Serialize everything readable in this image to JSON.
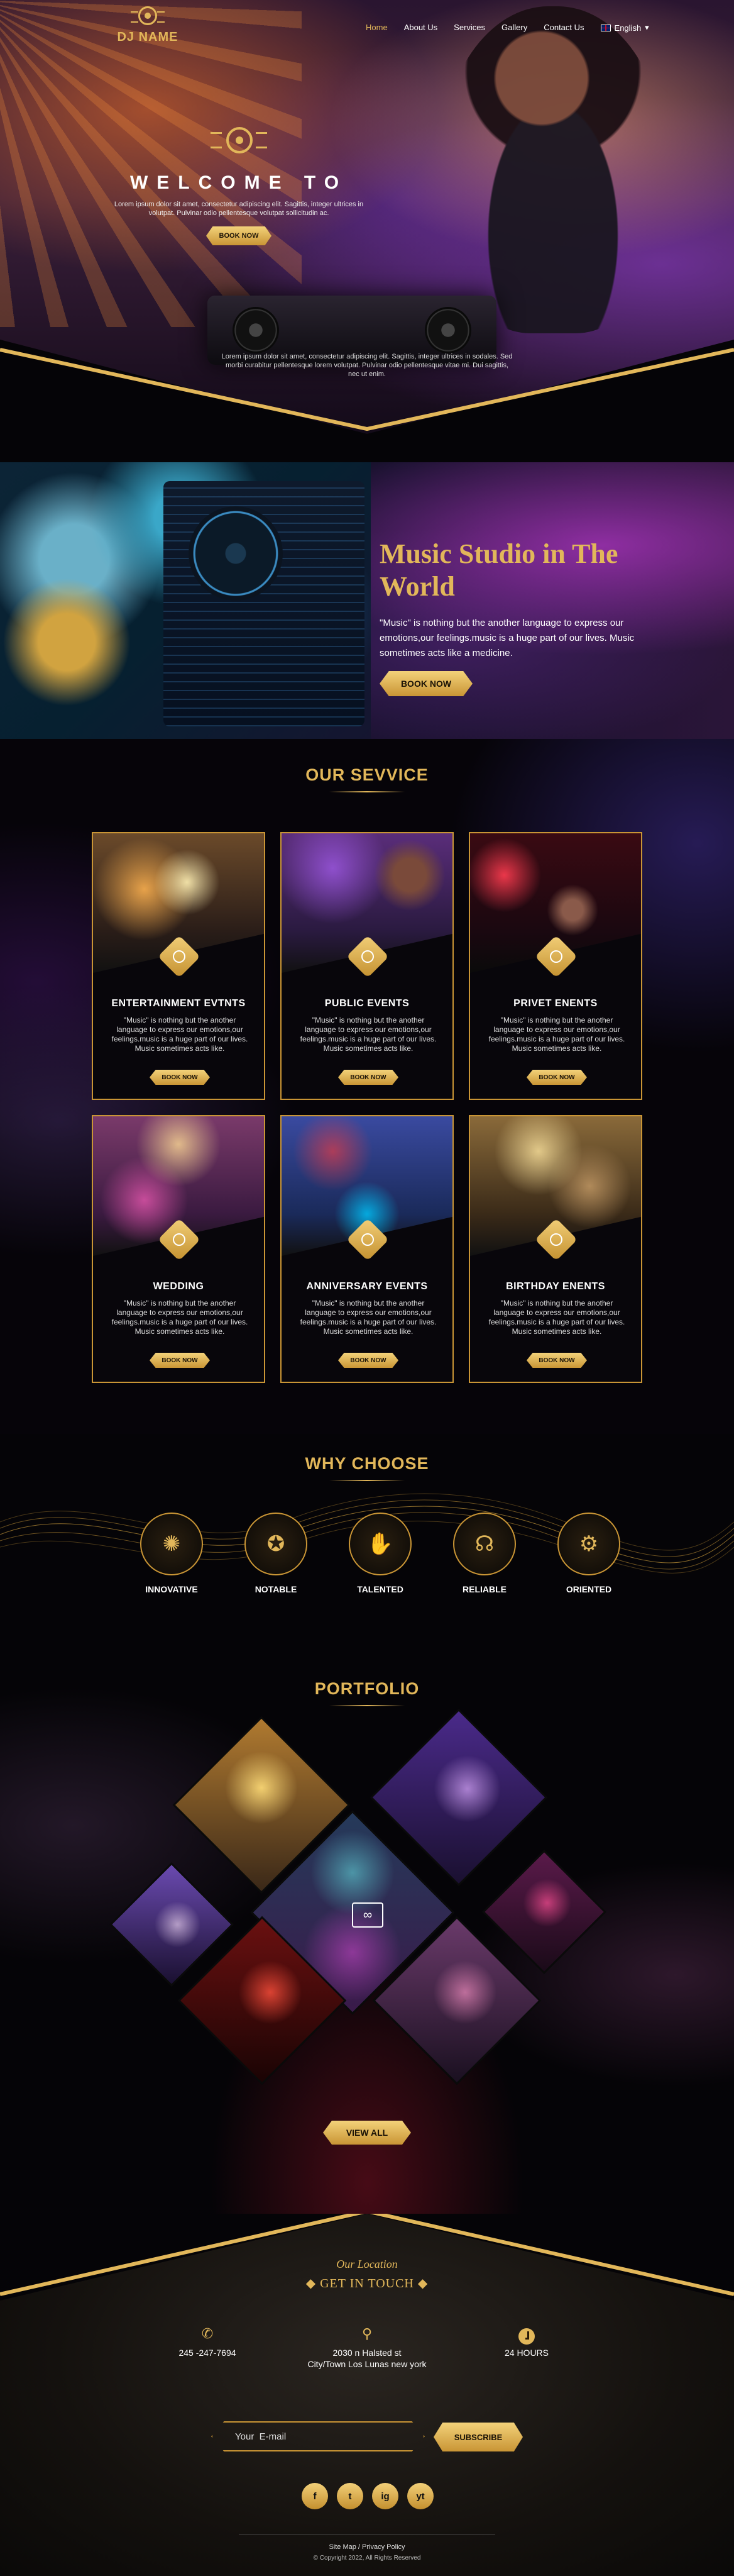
{
  "brand": {
    "name": "DJ NAME",
    "accent": "#e2b75a"
  },
  "nav": {
    "items": [
      "Home",
      "About Us",
      "Services",
      "Gallery",
      "Contact Us"
    ],
    "active": "Home",
    "language": "English"
  },
  "hero": {
    "title": "WELCOME TO",
    "text": "Lorem ipsum dolor sit amet, consectetur adipiscing elit. Sagittis, integer ultrices in volutpat. Pulvinar odio pellentesque volutpat sollicitudin ac.",
    "button": "BOOK NOW",
    "bottom_text": "Lorem ipsum dolor sit amet, consectetur adipiscing elit. Sagittis, integer ultrices in sodales. Sed morbi curabitur pellentesque lorem volutpat. Pulvinar odio pellentesque vitae mi. Dui sagittis, nec ut enim."
  },
  "studio": {
    "title": "Music Studio in The World",
    "text": "\"Music\" is nothing but the another language to express our emotions,our feelings.music is a huge part of our lives. Music sometimes acts like a medicine.",
    "button": "BOOK NOW"
  },
  "services": {
    "title": "OUR SEVVICE",
    "cards": [
      {
        "title": "ENTERTAINMENT EVTNTS",
        "desc": "\"Music\" is nothing but the another language to express our emotions,our feelings.music is a huge part of our lives. Music sometimes acts like.",
        "button": "BOOK NOW"
      },
      {
        "title": "PUBLIC EVENTS",
        "desc": "\"Music\" is nothing but the another language to express our emotions,our feelings.music is a huge part of our lives. Music sometimes acts like.",
        "button": "BOOK NOW"
      },
      {
        "title": "PRIVET ENENTS",
        "desc": "\"Music\" is nothing but the another language to express our emotions,our feelings.music is a huge part of our lives. Music sometimes acts like.",
        "button": "BOOK NOW"
      },
      {
        "title": "WEDDING",
        "desc": "\"Music\" is nothing but the another language to express our emotions,our feelings.music is a huge part of our lives. Music sometimes acts like.",
        "button": "BOOK NOW"
      },
      {
        "title": "ANNIVERSARY EVENTS",
        "desc": "\"Music\" is nothing but the another language to express our emotions,our feelings.music is a huge part of our lives. Music sometimes acts like.",
        "button": "BOOK NOW"
      },
      {
        "title": "BIRTHDAY ENENTS",
        "desc": "\"Music\" is nothing but the another language to express our emotions,our feelings.music is a huge part of our lives. Music sometimes acts like.",
        "button": "BOOK NOW"
      }
    ]
  },
  "why": {
    "title": "WHY CHOOSE",
    "features": [
      {
        "label": "INNOVATIVE",
        "icon": "lightbulb-icon"
      },
      {
        "label": "NOTABLE",
        "icon": "award-ribbon-icon"
      },
      {
        "label": "TALENTED",
        "icon": "hands-icon"
      },
      {
        "label": "RELIABLE",
        "icon": "headphones-person-icon"
      },
      {
        "label": "ORIENTED",
        "icon": "brain-gear-icon"
      }
    ]
  },
  "portfolio": {
    "title": "PORTFOLIO",
    "button": "VIEW ALL"
  },
  "footer": {
    "script": "Our Location",
    "title": "GET IN TOUCH",
    "phone": "245 -247-7694",
    "address_line1": "2030 n Halsted st",
    "address_line2": "City/Town Los Lunas new york",
    "hours": "24 HOURS",
    "email_placeholder": "Your  E-mail",
    "subscribe": "SUBSCRIBE",
    "socials": [
      "f",
      "t",
      "ig",
      "yt"
    ],
    "links": "Site Map / Privacy Policy",
    "copyright": "© Copyright 2022, All Rights Reserved"
  }
}
